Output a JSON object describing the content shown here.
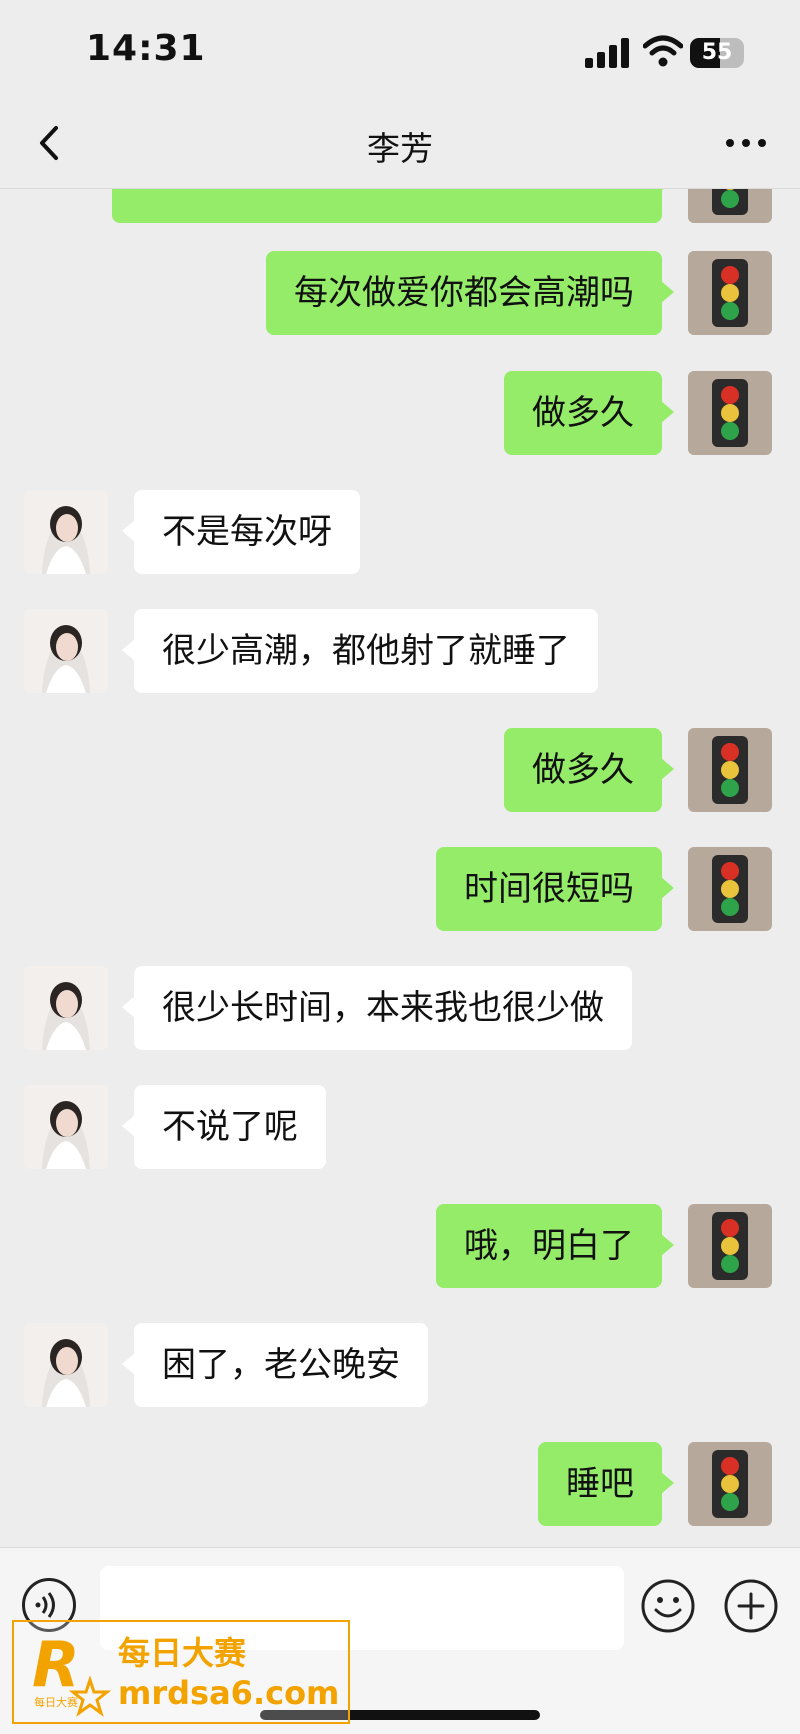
{
  "status_bar": {
    "time": "14:31",
    "battery": "55",
    "battery_level": 0.55
  },
  "nav": {
    "title": "李芳"
  },
  "messages": [
    {
      "side": "right",
      "text": "每次做爱你都会高潮吗"
    },
    {
      "side": "right",
      "text": "做多久"
    },
    {
      "side": "left",
      "text": "不是每次呀"
    },
    {
      "side": "left",
      "text": "很少高潮，都他射了就睡了"
    },
    {
      "side": "right",
      "text": "做多久"
    },
    {
      "side": "right",
      "text": "时间很短吗"
    },
    {
      "side": "left",
      "text": "很少长时间，本来我也很少做"
    },
    {
      "side": "left",
      "text": "不说了呢"
    },
    {
      "side": "right",
      "text": "哦，明白了"
    },
    {
      "side": "left",
      "text": "困了，老公晚安"
    },
    {
      "side": "right",
      "text": "睡吧"
    }
  ],
  "input": {
    "value": "",
    "placeholder": ""
  },
  "watermark": {
    "logo_letter": "R",
    "logo_small": "每日大赛",
    "title": "每日大赛",
    "url": "mrdsa6.com"
  },
  "colors": {
    "sent_bubble": "#95ec69",
    "received_bubble": "#ffffff",
    "background": "#ededed",
    "watermark": "#f3a300"
  },
  "icons": {
    "my_avatar": "traffic-light-icon",
    "her_avatar": "profile-photo",
    "voice": "voice-icon",
    "emoji": "emoji-icon",
    "plus": "plus-icon"
  }
}
